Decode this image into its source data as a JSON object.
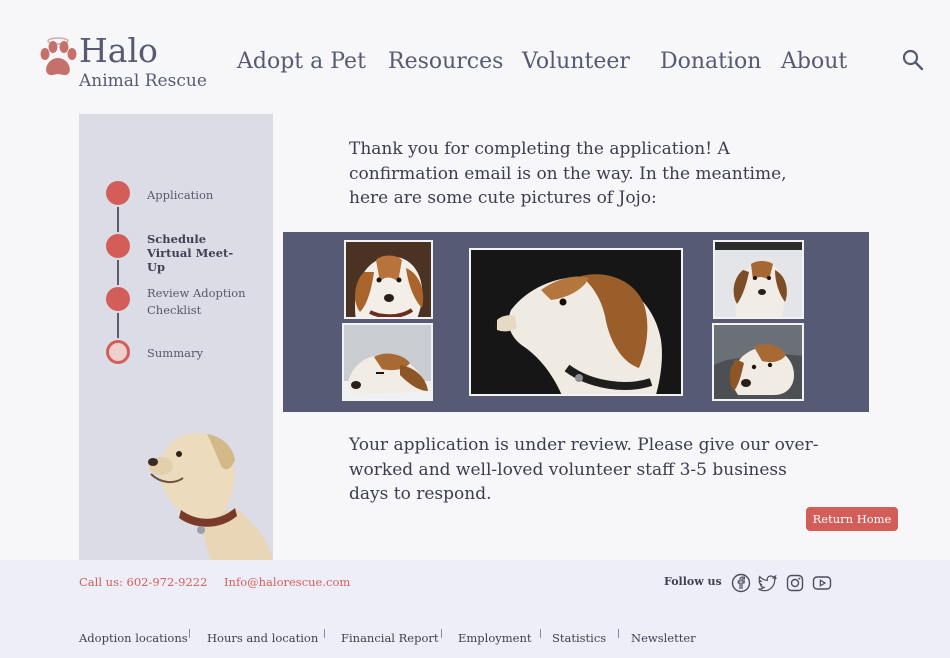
{
  "brand": {
    "name": "Halo",
    "tagline": "Animal Rescue",
    "accent_color": "#d35e59",
    "nav_text_color": "#565a72"
  },
  "nav": {
    "items": [
      "Adopt a Pet",
      "Resources",
      "Volunteer",
      "Donation",
      "About"
    ],
    "search_icon": "search-icon"
  },
  "steps": {
    "items": [
      {
        "label": "Application",
        "state": "complete"
      },
      {
        "label": "Schedule Virtual Meet-Up",
        "state": "complete"
      },
      {
        "label": "Review Adoption Checklist",
        "state": "complete"
      },
      {
        "label": "Summary",
        "state": "current"
      }
    ]
  },
  "main": {
    "intro": "Thank you for completing the application! A confirmation email is on the way.  In the meantime, here are some cute pictures of Jojo:",
    "review": "Your application is under review. Please give our over-worked and well-loved volunteer staff 3-5 business days to respond.",
    "return_button": "Return Home"
  },
  "footer": {
    "phone": "Call us: 602-972-9222",
    "email": "Info@halorescue.com",
    "follow_label": "Follow us",
    "social_icons": [
      "facebook-icon",
      "twitter-icon",
      "instagram-icon",
      "youtube-icon"
    ],
    "links": [
      "Adoption locations",
      "Hours and location",
      "Financial Report",
      "Employment",
      "Statistics",
      "Newsletter"
    ]
  }
}
